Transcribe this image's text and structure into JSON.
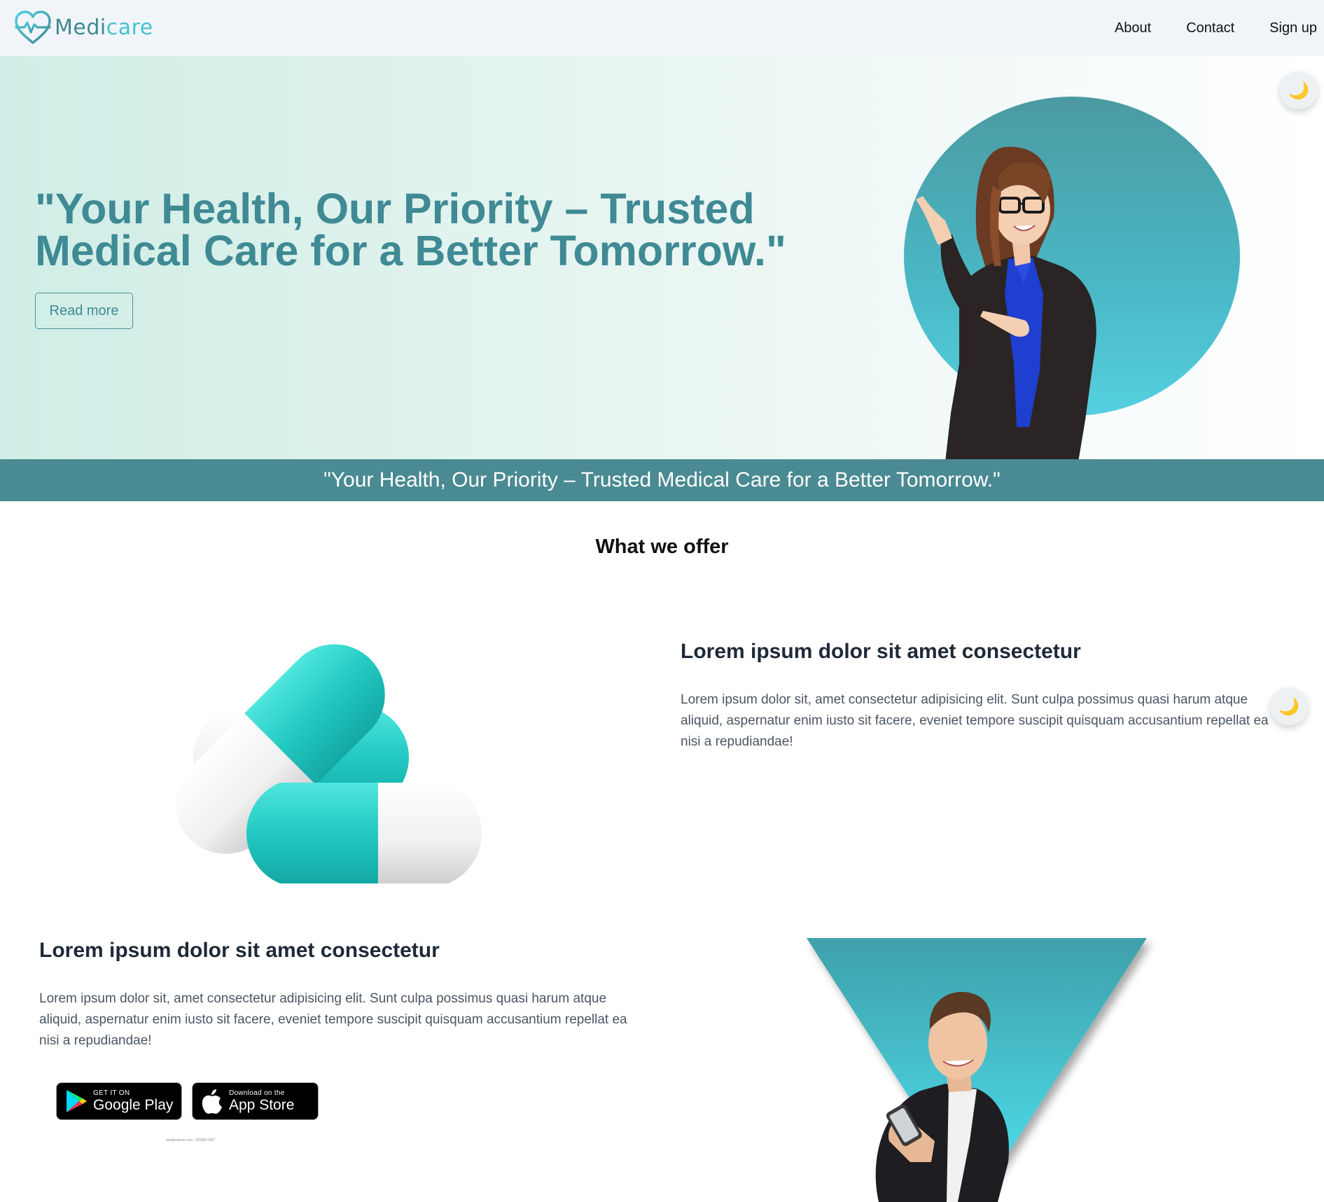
{
  "brand": {
    "name_part1": "Medi",
    "name_part2": "care",
    "color_primary": "#3f8a94",
    "color_accent": "#44c3cf"
  },
  "nav": {
    "items": [
      {
        "label": "About"
      },
      {
        "label": "Contact"
      },
      {
        "label": "Sign up"
      }
    ]
  },
  "hero": {
    "title": "\"Your Health, Our Priority – Trusted Medical Care for a Better Tomorrow.\"",
    "button_label": "Read more"
  },
  "theme_toggle": {
    "icon": "moon-icon",
    "glyph": "🌙"
  },
  "banner": {
    "text": "\"Your Health, Our Priority – Trusted Medical Care for a Better Tomorrow.\""
  },
  "offer": {
    "title": "What we offer",
    "features": [
      {
        "heading": "Lorem ipsum dolor sit amet consectetur",
        "text": "Lorem ipsum dolor sit, amet consectetur adipisicing elit. Sunt culpa possimus quasi harum atque aliquid, aspernatur enim iusto sit facere, eveniet tempore suscipit quisquam accusantium repellat ea nisi a repudiandae!"
      },
      {
        "heading": "Lorem ipsum dolor sit amet consectetur",
        "text": "Lorem ipsum dolor sit, amet consectetur adipisicing elit. Sunt culpa possimus quasi harum atque aliquid, aspernatur enim iusto sit facere, eveniet tempore suscipit quisquam accusantium repellat ea nisi a repudiandae!"
      }
    ]
  },
  "stores": {
    "google": {
      "small": "GET IT ON",
      "big": "Google Play"
    },
    "apple": {
      "small": "Download on the",
      "big": "App Store"
    },
    "credit": "shutterstock.com · 2209917807"
  }
}
